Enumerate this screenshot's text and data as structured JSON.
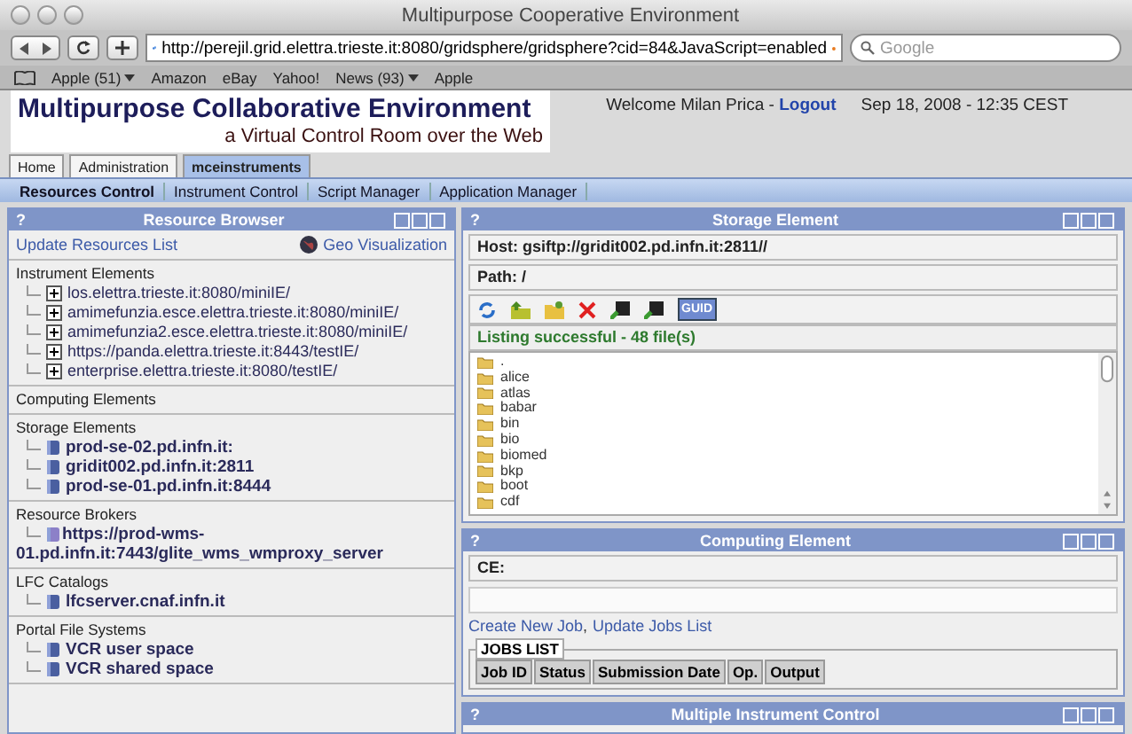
{
  "window": {
    "title": "Multipurpose Cooperative Environment"
  },
  "toolbar": {
    "url": "http://perejil.grid.elettra.trieste.it:8080/gridsphere/gridsphere?cid=84&JavaScript=enabled",
    "search_placeholder": "Google"
  },
  "bookmarks": [
    {
      "label": "Apple (51)",
      "menu": true
    },
    {
      "label": "Amazon",
      "menu": false
    },
    {
      "label": "eBay",
      "menu": false
    },
    {
      "label": "Yahoo!",
      "menu": false
    },
    {
      "label": "News (93)",
      "menu": true
    },
    {
      "label": "Apple",
      "menu": false
    }
  ],
  "header": {
    "title": "Multipurpose Collaborative Environment",
    "subtitle": "a Virtual Control Room over the Web",
    "welcome": "Welcome Milan Prica - ",
    "logout": "Logout",
    "date": "Sep 18, 2008 - 12:35 CEST"
  },
  "tabs": [
    {
      "label": "Home",
      "selected": false
    },
    {
      "label": "Administration",
      "selected": false
    },
    {
      "label": "mceinstruments",
      "selected": true
    }
  ],
  "subnav": [
    "Resources Control",
    "Instrument Control",
    "Script Manager",
    "Application Manager"
  ],
  "resource_browser": {
    "help": "?",
    "title": "Resource Browser",
    "update_link": "Update Resources List",
    "geo_link": "Geo Visualization",
    "sections": [
      {
        "title": "Instrument Elements",
        "items": [
          {
            "label": "los.elettra.trieste.it:8080/miniIE/",
            "kind": "expandable"
          },
          {
            "label": "amimefunzia.esce.elettra.trieste.it:8080/miniIE/",
            "kind": "expandable"
          },
          {
            "label": "amimefunzia2.esce.elettra.trieste.it:8080/miniIE/",
            "kind": "expandable"
          },
          {
            "label": "https://panda.elettra.trieste.it:8443/testIE/",
            "kind": "expandable"
          },
          {
            "label": "enterprise.elettra.trieste.it:8080/testIE/",
            "kind": "expandable"
          }
        ]
      },
      {
        "title": "Computing Elements"
      },
      {
        "title": "Storage Elements",
        "items": [
          {
            "label": "prod-se-02.pd.infn.it:",
            "kind": "resource"
          },
          {
            "label": "gridit002.pd.infn.it:2811",
            "kind": "resource"
          },
          {
            "label": "prod-se-01.pd.infn.it:8444",
            "kind": "resource"
          }
        ]
      },
      {
        "title": "Resource Brokers",
        "items": [
          {
            "label": "https://prod-wms-01.pd.infn.it:7443/glite_wms_wmproxy_server",
            "kind": "broker"
          }
        ]
      },
      {
        "title": "LFC Catalogs",
        "items": [
          {
            "label": "lfcserver.cnaf.infn.it",
            "kind": "resource"
          }
        ]
      },
      {
        "title": "Portal File Systems",
        "items": [
          {
            "label": "VCR user space",
            "kind": "resource"
          },
          {
            "label": "VCR shared space",
            "kind": "resource"
          }
        ]
      }
    ]
  },
  "storage_element": {
    "help": "?",
    "title": "Storage Element",
    "host": "Host: gsiftp://gridit002.pd.infn.it:2811//",
    "path": "Path: /",
    "guid": "GUID",
    "status": "Listing successful - 48 file(s)",
    "files": [
      ".",
      "alice",
      "atlas",
      "babar",
      "bin",
      "bio",
      "biomed",
      "bkp",
      "boot",
      "cdf"
    ]
  },
  "computing_element": {
    "help": "?",
    "title": "Computing Element",
    "ce_label": "CE:",
    "create_link": "Create New Job",
    "separator": ",",
    "update_link": "Update Jobs List",
    "jobs_legend": "JOBS LIST",
    "columns": [
      "Job ID",
      "Status",
      "Submission Date",
      "Op.",
      "Output"
    ]
  },
  "instrument_control": {
    "help": "?",
    "title": "Multiple Instrument Control"
  }
}
